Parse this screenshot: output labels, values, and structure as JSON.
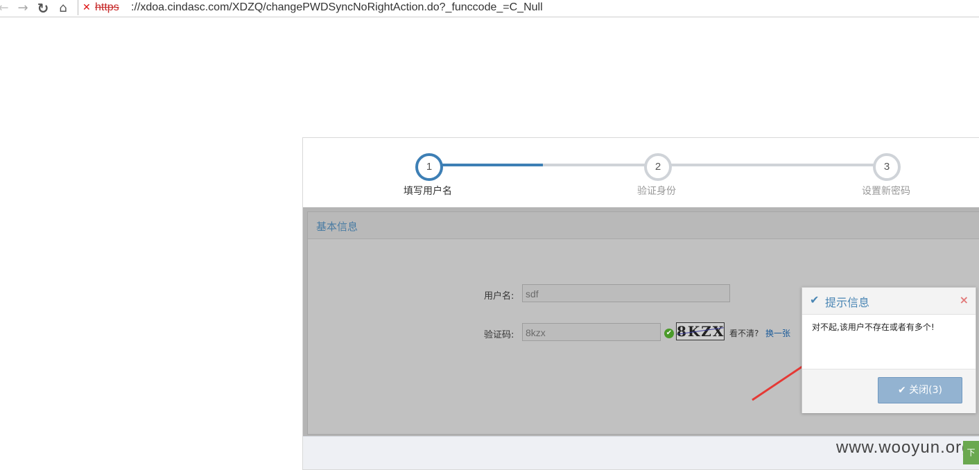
{
  "browser": {
    "url_scheme": "https",
    "url_rest": "://xdoa.cindasc.com/XDZQ/changePWDSyncNoRightAction.do?_funccode_=C_Null",
    "icons": [
      "back-icon",
      "forward-icon",
      "reload-icon",
      "home-icon",
      "security-warning-icon"
    ]
  },
  "steps": [
    {
      "number": "1",
      "label": "填写用户名",
      "active": true
    },
    {
      "number": "2",
      "label": "验证身份",
      "active": false
    },
    {
      "number": "3",
      "label": "设置新密码",
      "active": false
    }
  ],
  "section": {
    "title": "基本信息"
  },
  "form": {
    "username_label": "用户名:",
    "username_value": "sdf",
    "captcha_label": "验证码:",
    "captcha_value": "8kzx",
    "captcha_image_text": "8KZX",
    "unclear_text": "看不清?",
    "refresh_link": "换一张"
  },
  "dialog": {
    "title": "提示信息",
    "close_glyph": "×",
    "message": "对不起,该用户不存在或者有多个!",
    "button_label": "关闭(3)"
  },
  "watermark": "www.wooyun.org",
  "corner_tab": "下",
  "colors": {
    "accent": "#4a86b4",
    "step_active": "#3d7fb5",
    "step_inactive": "#cfd3d8",
    "annotation_arrow": "#e53935"
  }
}
